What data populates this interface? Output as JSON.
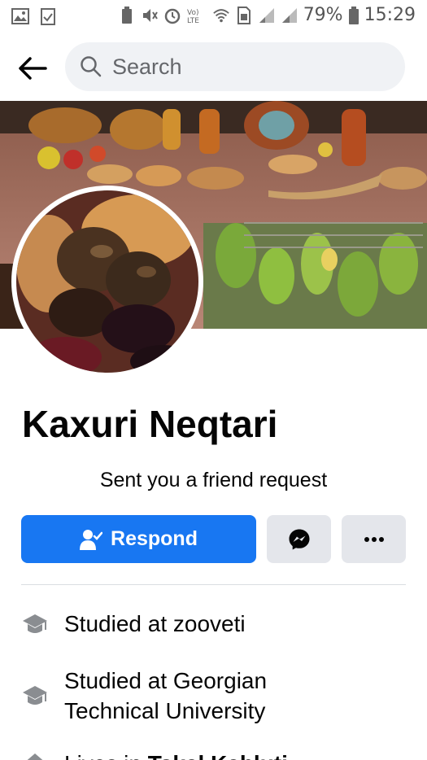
{
  "status_bar": {
    "battery": "79%",
    "time": "15:29",
    "lte_label": "Vo) LTE"
  },
  "header": {
    "search_placeholder": "Search"
  },
  "profile": {
    "name": "Kaxuri Neqtari",
    "subtitle": "Sent you a friend request"
  },
  "actions": {
    "respond_label": "Respond",
    "more_label": "•••"
  },
  "info": {
    "education_1": "Studied at zooveti",
    "education_2": "Studied at Georgian Technical University",
    "lives_prefix": "Lives in ",
    "lives_place": "Tskal Kabluti"
  },
  "colors": {
    "primary": "#1877f2",
    "button_gray": "#e4e6eb",
    "search_bg": "#f0f2f5"
  }
}
